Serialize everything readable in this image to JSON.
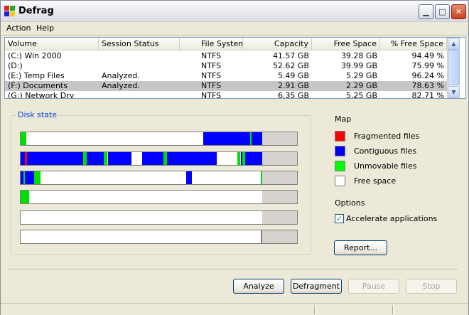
{
  "window": {
    "title": "Defrag"
  },
  "menu": [
    "Action",
    "Help"
  ],
  "columns": [
    "Volume",
    "Session Status",
    "File System",
    "Capacity",
    "Free Space",
    "% Free Space"
  ],
  "volumes": [
    {
      "volume": "(C:) Win 2000",
      "status": "",
      "fs": "NTFS",
      "capacity": "41.57 GB",
      "free": "39.28 GB",
      "pct": "94.49 %"
    },
    {
      "volume": "(D:)",
      "status": "",
      "fs": "NTFS",
      "capacity": "52.62 GB",
      "free": "39.99 GB",
      "pct": "75.99 %"
    },
    {
      "volume": "(E:) Temp Files",
      "status": "Analyzed.",
      "fs": "NTFS",
      "capacity": "5.49 GB",
      "free": "5.29 GB",
      "pct": "96.24 %"
    },
    {
      "volume": "(F:) Documents",
      "status": "Analyzed.",
      "fs": "NTFS",
      "capacity": "2.91 GB",
      "free": "2.29 GB",
      "pct": "78.63 %",
      "selected": true
    },
    {
      "volume": "(G:) Network Drv",
      "status": "",
      "fs": "NTFS",
      "capacity": "6.35 GB",
      "free": "5.25 GB",
      "pct": "82.71 %"
    }
  ],
  "disk_state": {
    "label": "Disk state",
    "rows": [
      [
        [
          "unmovable",
          0,
          2
        ],
        [
          "free",
          2,
          66
        ],
        [
          "contiguous",
          66,
          83
        ],
        [
          "unmovable",
          83,
          83.6
        ],
        [
          "contiguous",
          83.6,
          87.5
        ],
        [
          "unused",
          87.5,
          100
        ]
      ],
      [
        [
          "contiguous",
          0,
          1.5
        ],
        [
          "fragmented",
          1.5,
          2.2
        ],
        [
          "contiguous",
          2.2,
          22.5
        ],
        [
          "unmovable",
          22.5,
          24
        ],
        [
          "contiguous",
          24,
          30.2
        ],
        [
          "unmovable",
          30.2,
          31.5
        ],
        [
          "contiguous",
          31.5,
          40
        ],
        [
          "free",
          40,
          44
        ],
        [
          "contiguous",
          44,
          51.7
        ],
        [
          "unmovable",
          51.7,
          53
        ],
        [
          "contiguous",
          53,
          71
        ],
        [
          "free",
          71,
          78.5
        ],
        [
          "unmovable",
          78.5,
          79.6
        ],
        [
          "contiguous",
          79.6,
          80.3
        ],
        [
          "unmovable",
          80.3,
          81.2
        ],
        [
          "contiguous",
          81.2,
          87.5
        ],
        [
          "unused",
          87.5,
          100
        ]
      ],
      [
        [
          "contiguous",
          0,
          1
        ],
        [
          "unmovable",
          1,
          1.5
        ],
        [
          "contiguous",
          1.5,
          5
        ],
        [
          "unmovable",
          5,
          7.2
        ],
        [
          "free",
          7.2,
          60
        ],
        [
          "contiguous",
          60,
          62
        ],
        [
          "free",
          62,
          87
        ],
        [
          "unmovable",
          87,
          87.5
        ],
        [
          "unused",
          87.5,
          100
        ]
      ],
      [
        [
          "unmovable",
          0,
          3
        ],
        [
          "free",
          3,
          87.5
        ],
        [
          "unused",
          87.5,
          100
        ]
      ],
      [
        [
          "free",
          0,
          87.5
        ],
        [
          "unused",
          87.5,
          100
        ]
      ],
      [
        [
          "free",
          0,
          87
        ],
        [
          "edge",
          87,
          87.6
        ],
        [
          "unused",
          87.6,
          100
        ]
      ]
    ]
  },
  "map": {
    "title": "Map",
    "items": [
      {
        "label": "Fragmented files",
        "color": "#ff0000"
      },
      {
        "label": "Contiguous files",
        "color": "#0000ff"
      },
      {
        "label": "Unmovable files",
        "color": "#00ff00"
      },
      {
        "label": "Free space",
        "color": "#ffffff"
      }
    ]
  },
  "options": {
    "title": "Options",
    "accelerate_label": "Accelerate applications",
    "accelerate_checked": true
  },
  "buttons": {
    "report": "Report...",
    "analyze": "Analyze",
    "defragment": "Defragment",
    "pause": "Pause",
    "stop": "Stop"
  },
  "colors": {
    "fragmented": "#ff0000",
    "contiguous": "#0000ff",
    "unmovable": "#00e000",
    "free": "#ffffff",
    "unused": "#d6d3ce",
    "edge": "#808080"
  }
}
